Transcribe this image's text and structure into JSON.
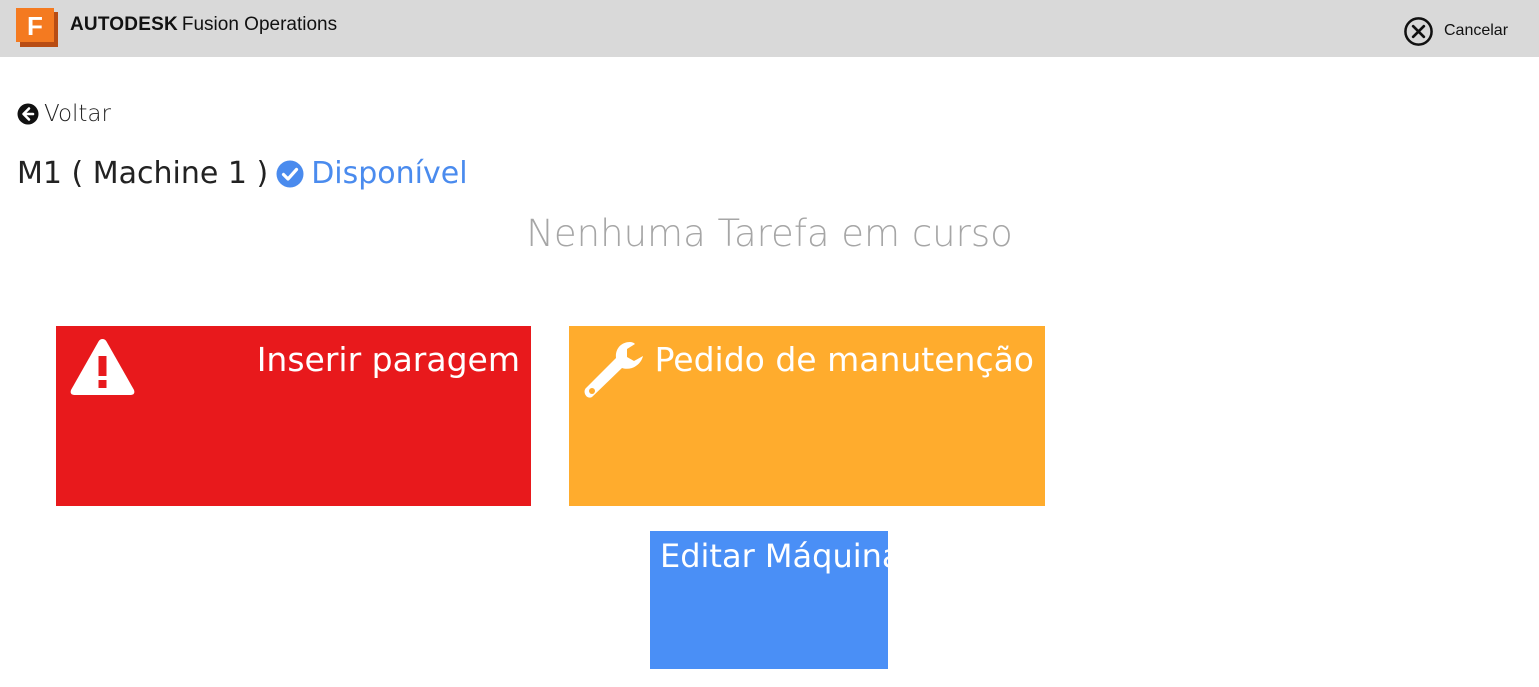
{
  "header": {
    "logo_letter": "F",
    "brand_bold": "AUTODESK",
    "brand_product": "Fusion Operations",
    "cancel_label": "Cancelar"
  },
  "nav": {
    "back_label": "Voltar"
  },
  "machine": {
    "name": "M1 ( Machine 1 )",
    "status": "Disponível"
  },
  "message": "Nenhuma Tarefa em curso",
  "tiles": [
    {
      "label": "Inserir paragem",
      "color": "#e8191c",
      "icon": "warning-icon"
    },
    {
      "label": "Pedido de manutenção",
      "color": "#ffac2d",
      "icon": "wrench-icon"
    },
    {
      "label": "Editar Máquina",
      "color": "#4a8ff6",
      "icon": ""
    }
  ],
  "colors": {
    "topbar": "#d9d9d9",
    "status_blue": "#4a8bee",
    "logo_orange": "#f47a20"
  }
}
